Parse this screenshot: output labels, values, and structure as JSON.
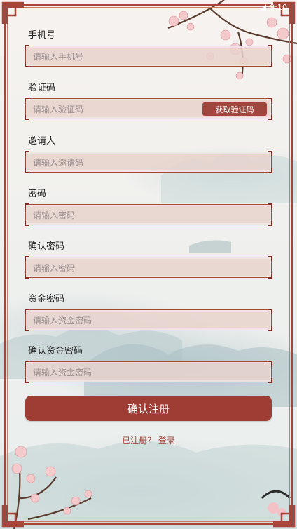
{
  "status_bar": {
    "time": "9:10"
  },
  "form": {
    "fields": [
      {
        "label": "手机号",
        "placeholder": "请输入手机号"
      },
      {
        "label": "验证码",
        "placeholder": "请输入验证码",
        "action": "获取验证码"
      },
      {
        "label": "邀请人",
        "placeholder": "请输入邀请码"
      },
      {
        "label": "密码",
        "placeholder": "请输入密码"
      },
      {
        "label": "确认密码",
        "placeholder": "请输入密码"
      },
      {
        "label": "资金密码",
        "placeholder": "请输入资金密码"
      },
      {
        "label": "确认资金密码",
        "placeholder": "请输入资金密码"
      }
    ],
    "submit_label": "确认注册",
    "registered_prompt": "已注册？",
    "login_link": "登录"
  },
  "colors": {
    "accent": "#a0463c",
    "frame": "#a8453a",
    "field_bg": "#e8d2cc"
  }
}
